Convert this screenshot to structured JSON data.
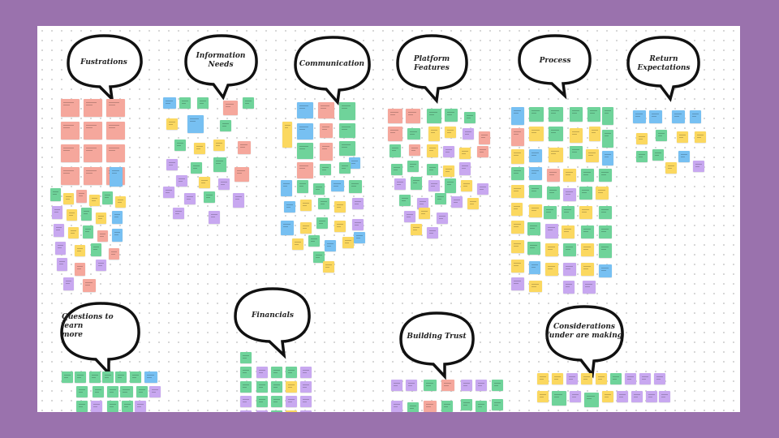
{
  "board": {
    "background": "#ffffff",
    "frame_color": "#9a72ad"
  },
  "note_colors": {
    "salmon": "#f5a79c",
    "green": "#6fd39a",
    "yellow": "#fbd860",
    "purple": "#c8a8f0",
    "blue": "#77c0f2"
  },
  "clusters": [
    {
      "id": "frustrations",
      "title_lines": [
        "Fustrations"
      ]
    },
    {
      "id": "information-needs",
      "title_lines": [
        "Information",
        "Needs"
      ]
    },
    {
      "id": "communication",
      "title_lines": [
        "Communication"
      ]
    },
    {
      "id": "platform-features",
      "title_lines": [
        "Platform",
        "Features"
      ]
    },
    {
      "id": "process",
      "title_lines": [
        "Process"
      ]
    },
    {
      "id": "return-expectations",
      "title_lines": [
        "Return",
        "Expectations"
      ]
    },
    {
      "id": "questions-to-learn-more",
      "title_lines": [
        "Questions to learn",
        "more"
      ]
    },
    {
      "id": "financials",
      "title_lines": [
        "Financials"
      ]
    },
    {
      "id": "building-trust",
      "title_lines": [
        "Building Trust"
      ]
    },
    {
      "id": "considerations",
      "title_lines": [
        "Considerations",
        "funder are making"
      ]
    }
  ]
}
